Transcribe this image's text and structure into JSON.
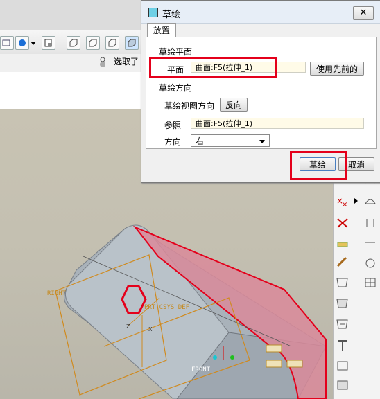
{
  "toolbar": {
    "filter_label": "选取了"
  },
  "dialog": {
    "title": "草绘",
    "close": "✕",
    "tab": "放置",
    "sketch_plane": {
      "section": "草绘平面",
      "plane_label": "平面",
      "plane_value": "曲面:F5(拉伸_1)",
      "use_previous": "使用先前的"
    },
    "sketch_orientation": {
      "section": "草绘方向",
      "view_direction_label": "草绘视图方向",
      "flip": "反向",
      "reference_label": "参照",
      "reference_value": "曲面:F5(拉伸_1)",
      "orientation_label": "方向",
      "orientation_value": "右"
    },
    "sketch_button": "草绘",
    "cancel_button": "取消"
  },
  "model": {
    "datum_right": "RIGHT",
    "datum_front": "FRONT",
    "csys": "PRT_CSYS_DEF",
    "axis_z": "Z",
    "axis_x": "X"
  },
  "colors": {
    "highlight": "#e4001b",
    "selected_face": "#d98a9a",
    "datum": "#d08a1e"
  }
}
